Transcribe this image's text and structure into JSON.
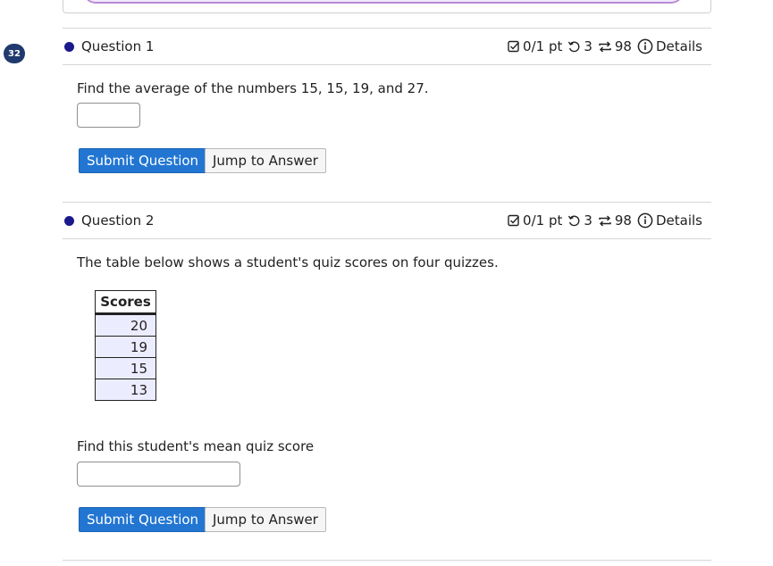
{
  "page": {
    "progress_badge": "32"
  },
  "questions": [
    {
      "title": "Question 1",
      "meta": {
        "score": "0/1 pt",
        "retries": "3",
        "attempts": "98",
        "details": "Details"
      },
      "prompt": "Find the average of the numbers 15, 15, 19, and 27.",
      "answer_value": "",
      "submit_label": "Submit Question",
      "jump_label": "Jump to Answer"
    },
    {
      "title": "Question 2",
      "meta": {
        "score": "0/1 pt",
        "retries": "3",
        "attempts": "98",
        "details": "Details"
      },
      "prompt": "The table below shows a student's quiz scores on four quizzes.",
      "table": {
        "header": "Scores",
        "rows": [
          "20",
          "19",
          "15",
          "13"
        ]
      },
      "prompt2": "Find this student's mean quiz score",
      "answer_value": "",
      "submit_label": "Submit Question",
      "jump_label": "Jump to Answer"
    }
  ],
  "colors": {
    "primary_button": "#2276d2",
    "badge": "#1e3a6e",
    "dot": "#1a1a8c",
    "table_cell": "#ececff"
  },
  "icons": [
    "checkbox-icon",
    "retry-icon",
    "attempts-icon",
    "info-icon"
  ]
}
